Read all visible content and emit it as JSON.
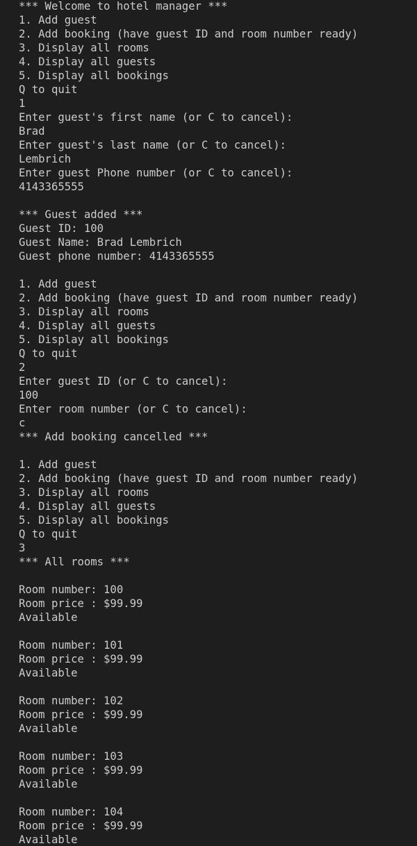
{
  "window": {
    "title": ""
  },
  "terminal": {
    "foreground": "#cccccc",
    "background": "#1e1e1e",
    "lines": [
      "*** Welcome to hotel manager ***",
      "1. Add guest",
      "2. Add booking (have guest ID and room number ready)",
      "3. Display all rooms",
      "4. Display all guests",
      "5. Display all bookings",
      "Q to quit",
      "1",
      "Enter guest's first name (or C to cancel):",
      "Brad",
      "Enter guest's last name (or C to cancel):",
      "Lembrich",
      "Enter guest Phone number (or C to cancel):",
      "4143365555",
      "",
      "*** Guest added ***",
      "Guest ID: 100",
      "Guest Name: Brad Lembrich",
      "Guest phone number: 4143365555",
      "",
      "1. Add guest",
      "2. Add booking (have guest ID and room number ready)",
      "3. Display all rooms",
      "4. Display all guests",
      "5. Display all bookings",
      "Q to quit",
      "2",
      "Enter guest ID (or C to cancel):",
      "100",
      "Enter room number (or C to cancel):",
      "c",
      "*** Add booking cancelled ***",
      "",
      "1. Add guest",
      "2. Add booking (have guest ID and room number ready)",
      "3. Display all rooms",
      "4. Display all guests",
      "5. Display all bookings",
      "Q to quit",
      "3",
      "*** All rooms ***",
      "",
      "Room number: 100",
      "Room price : $99.99",
      "Available",
      "",
      "Room number: 101",
      "Room price : $99.99",
      "Available",
      "",
      "Room number: 102",
      "Room price : $99.99",
      "Available",
      "",
      "Room number: 103",
      "Room price : $99.99",
      "Available",
      "",
      "Room number: 104",
      "Room price : $99.99",
      "Available"
    ]
  }
}
